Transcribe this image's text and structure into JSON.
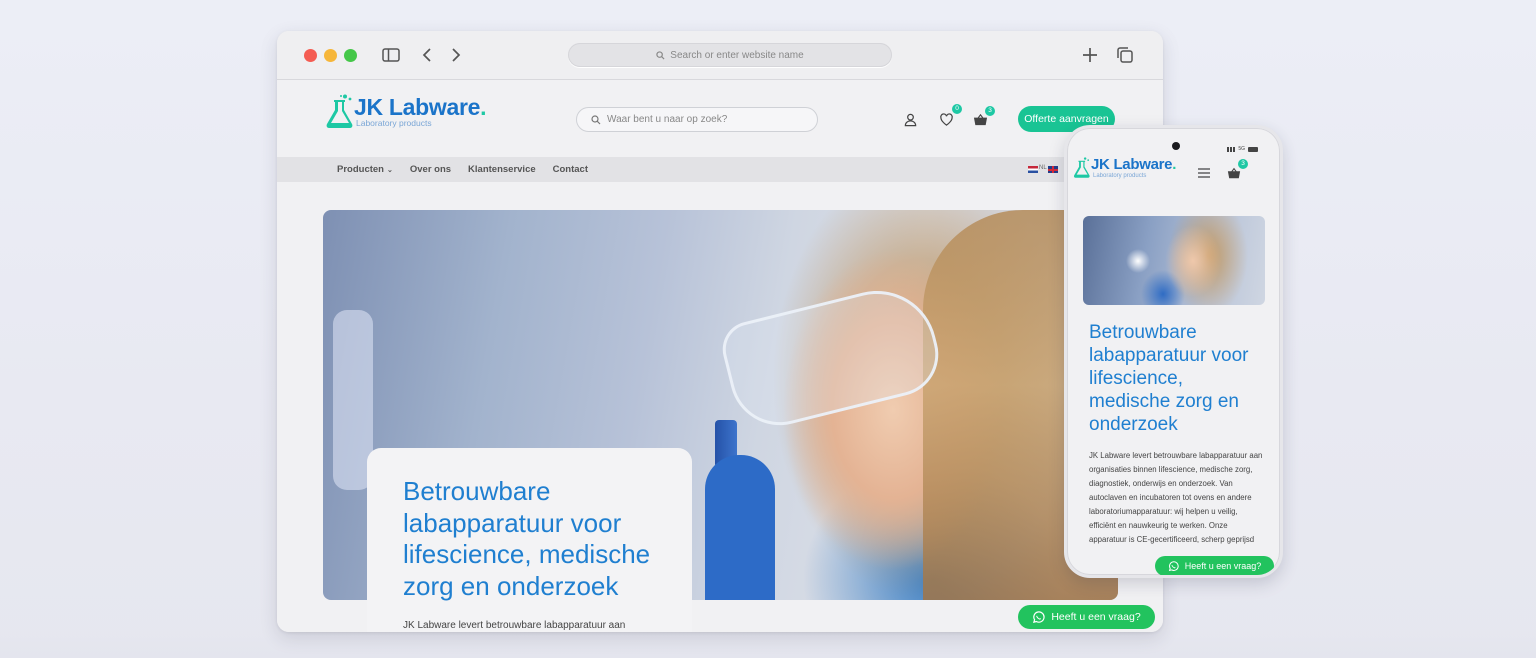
{
  "browser": {
    "url_placeholder": "Search or enter website name"
  },
  "site": {
    "brand": "JK Labware",
    "tagline": "Laboratory products",
    "search_placeholder": "Waar bent u naar op zoek?",
    "wishlist_count": "0",
    "cart_count": "3",
    "quote_button": "Offerte aanvragen",
    "nav": [
      "Producten",
      "Over ons",
      "Klantenservice",
      "Contact"
    ],
    "lang_label": "NL",
    "hero_title": "Betrouwbare labapparatuur voor lifescience, medische zorg en onderzoek",
    "hero_text": "JK Labware levert betrouwbare labapparatuur aan organisaties binnen lifescience, medische zorg,",
    "whatsapp_label": "Heeft u een vraag?"
  },
  "mobile": {
    "status": "5G",
    "cart_count": "3",
    "hero_title": "Betrouwbare labapparatuur voor lifescience, medische zorg en onderzoek",
    "hero_text": "JK Labware levert betrouwbare labapparatuur aan organisaties binnen lifescience, medische zorg, diagnostiek, onderwijs en onderzoek. Van autoclaven en incubatoren tot ovens en andere laboratoriumapparatuur: wij helpen u veilig, efficiënt en nauwkeurig te werken. Onze apparatuur is CE-gecertificeerd, scherp geprijsd",
    "whatsapp_label": "Heeft u een vraag?"
  },
  "colors": {
    "brand_blue": "#1f7fd0",
    "accent_green": "#19c494",
    "whatsapp_green": "#22c35e"
  }
}
